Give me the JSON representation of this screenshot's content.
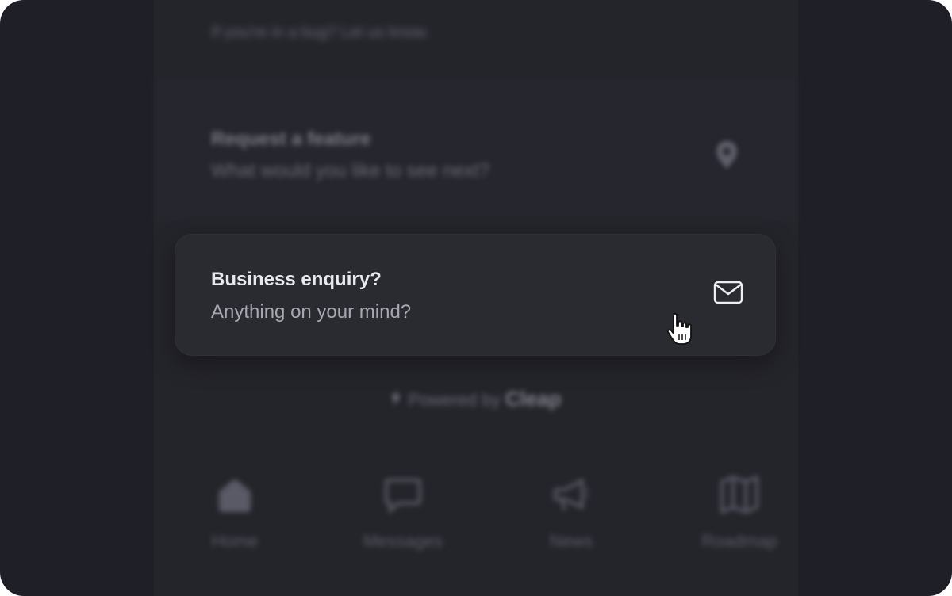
{
  "top_snippet": "If you're in a bug? Let us know.",
  "feature": {
    "title": "Request a feature",
    "subtitle": "What would you like to see next?",
    "icon": "map-pin-icon"
  },
  "business": {
    "title": "Business enquiry?",
    "subtitle": "Anything on your mind?",
    "icon": "mail-icon"
  },
  "powered": {
    "prefix": "Powered by",
    "brand": "Cleap"
  },
  "nav": {
    "items": [
      {
        "label": "Home",
        "icon": "home-icon"
      },
      {
        "label": "Messages",
        "icon": "chat-icon"
      },
      {
        "label": "News",
        "icon": "megaphone-icon"
      },
      {
        "label": "Roadmap",
        "icon": "map-icon"
      }
    ]
  },
  "colors": {
    "background": "#1f1f27",
    "panel": "#24242b",
    "card": "#2a2a31",
    "text_primary": "#e8e8ee",
    "text_secondary": "#a8a8b2"
  }
}
